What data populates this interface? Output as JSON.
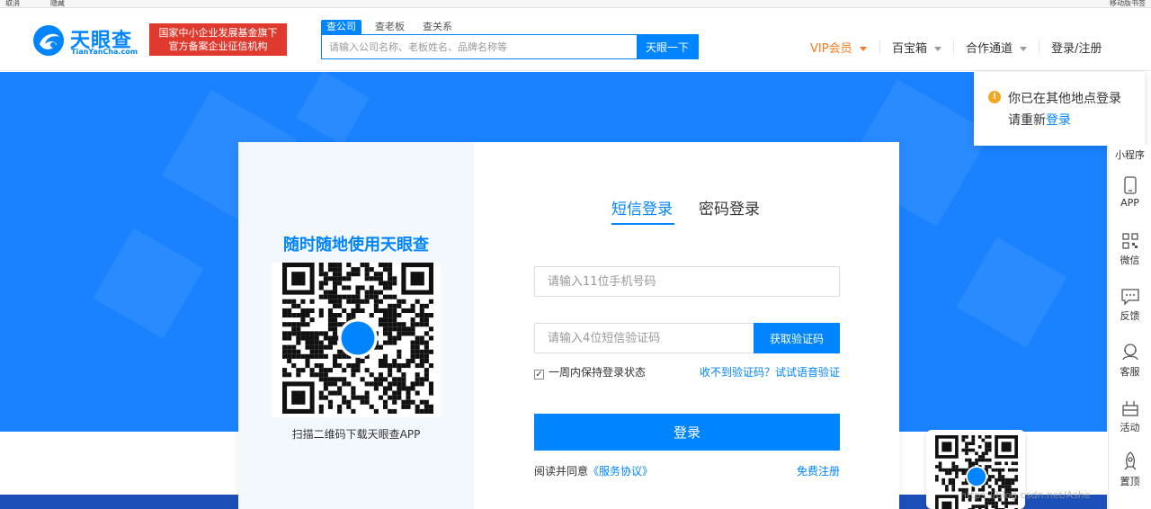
{
  "browser": {
    "bookmarks_left": "取消",
    "bookmarks_left2": "隐藏",
    "bookmarks_right": "移动版书签"
  },
  "header": {
    "logo_cn": "天眼查",
    "logo_en": "TianYanCha.com",
    "slogan_line1": "国家中小企业发展基金旗下",
    "slogan_line2": "官方备案企业征信机构",
    "search_tabs": [
      "查公司",
      "查老板",
      "查关系"
    ],
    "search_placeholder": "请输入公司名称、老板姓名、品牌名称等",
    "search_button": "天眼一下",
    "nav": {
      "vip": "VIP会员",
      "baibao": "百宝箱",
      "hezuo": "合作通道",
      "login": "登录/注册"
    }
  },
  "login_card": {
    "qr_title": "随时随地使用天眼查",
    "qr_caption": "扫描二维码下载天眼查APP",
    "tab_sms": "短信登录",
    "tab_password": "密码登录",
    "phone_placeholder": "请输入11位手机号码",
    "code_placeholder": "请输入4位短信验证码",
    "code_button": "获取验证码",
    "remember_label": "一周内保持登录状态",
    "remember_checked": true,
    "voice_link": "收不到验证码？试试语音验证",
    "login_button": "登录",
    "agree_prefix": "阅读并同意",
    "agree_link": "《服务协议》",
    "register_link": "免费注册"
  },
  "notice": {
    "line1": "你已在其他地点登录",
    "line2_prefix": "请重新",
    "line2_link": "登录"
  },
  "rail": [
    {
      "label": "小程序",
      "icon": "mini-program-icon"
    },
    {
      "label": "APP",
      "icon": "phone-icon"
    },
    {
      "label": "微信",
      "icon": "qrcode-icon"
    },
    {
      "label": "反馈",
      "icon": "chat-icon"
    },
    {
      "label": "客服",
      "icon": "headset-icon"
    },
    {
      "label": "活动",
      "icon": "gift-icon"
    },
    {
      "label": "置顶",
      "icon": "rocket-icon"
    }
  ],
  "watermark": "https://blog.csdn.net/Ashe",
  "colors": {
    "brand_blue": "#0084ff",
    "hero_blue": "#1a82ff",
    "slogan_red": "#e03a2f",
    "vip_orange": "#ff7a1a",
    "notice_icon": "#f5a623"
  }
}
